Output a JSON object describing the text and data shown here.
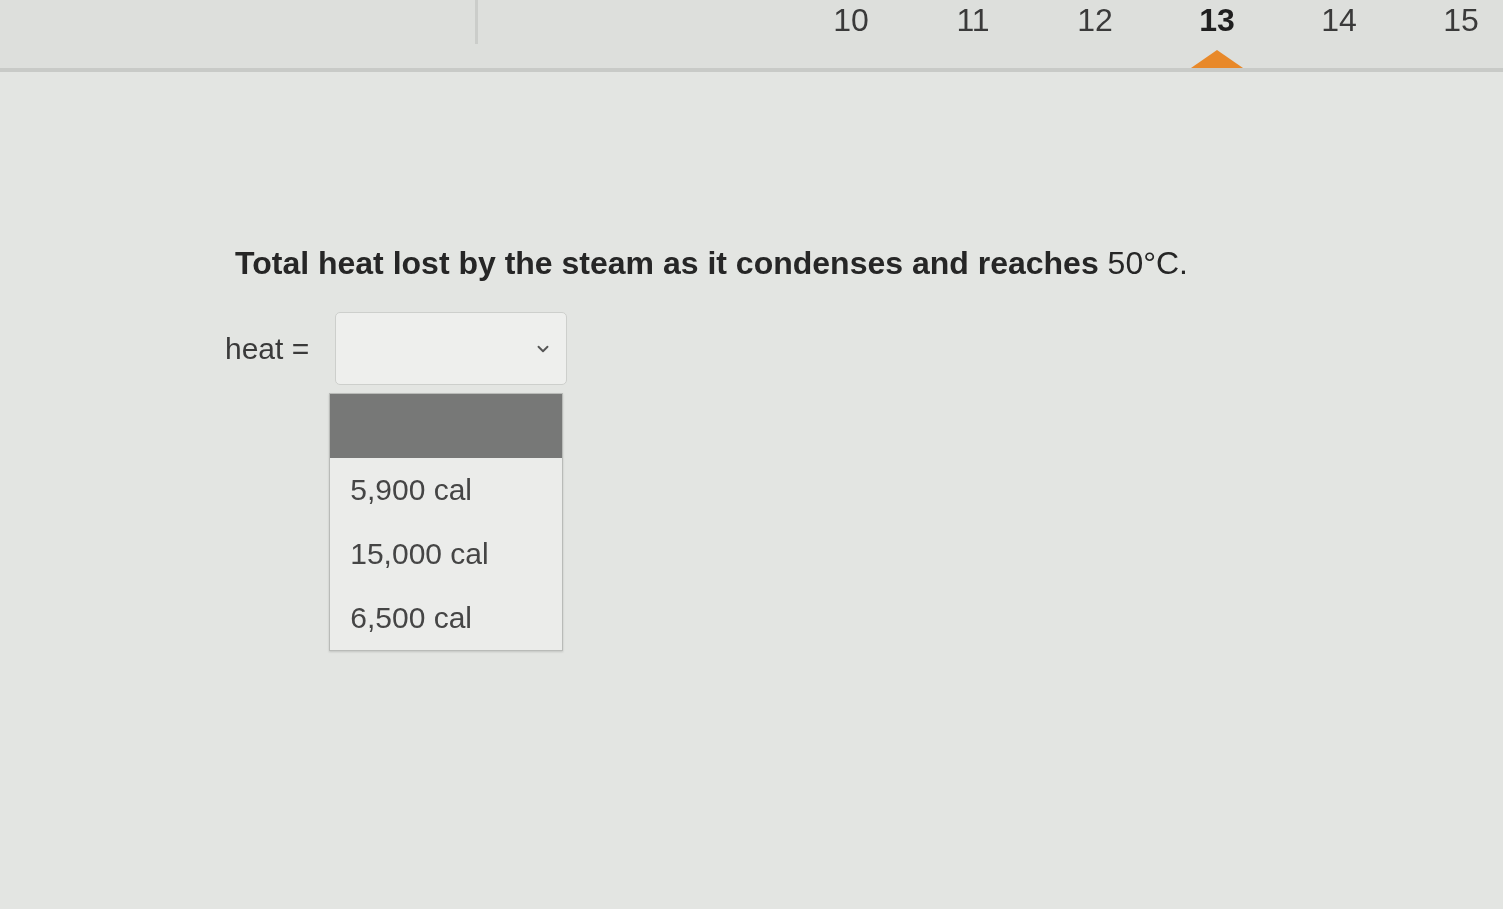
{
  "question_nav": {
    "items": [
      {
        "label": "10",
        "selected": false
      },
      {
        "label": "11",
        "selected": false
      },
      {
        "label": "12",
        "selected": false
      },
      {
        "label": "13",
        "selected": true
      },
      {
        "label": "14",
        "selected": false
      },
      {
        "label": "15",
        "selected": false
      }
    ]
  },
  "question": {
    "text": "**Total heat lost by the steam as it condenses and reaches** 50°C."
  },
  "answer": {
    "label": "heat =",
    "dropdown": {
      "expanded": true,
      "options": [
        {
          "selected": true
        },
        {
          "label": "5,900 cal",
          "selected": false
        },
        {
          "label": "15,000 cal",
          "selected": false
        },
        {
          "label": "6,500 cal",
          "selected": false
        }
      ]
    }
  }
}
